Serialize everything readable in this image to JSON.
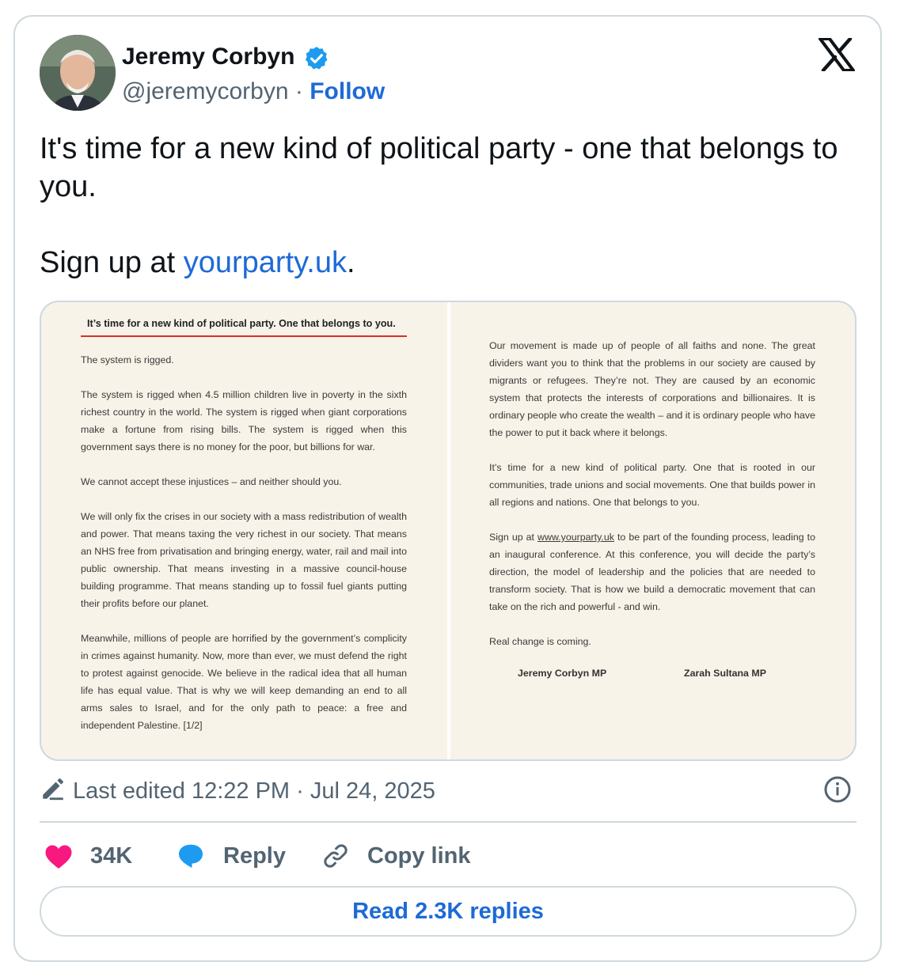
{
  "author": {
    "name": "Jeremy Corbyn",
    "handle": "@jeremycorbyn",
    "separator": "·",
    "follow_label": "Follow",
    "verified_icon": "verified-badge-icon",
    "avatar_icon": "profile-photo"
  },
  "brand_icon": "x-logo-icon",
  "tweet": {
    "line1": "It's time for a new kind of political party - one that belongs to you.",
    "line2_prefix": "Sign up at ",
    "line2_link": "yourparty.uk",
    "line2_suffix": "."
  },
  "media": {
    "title": "It’s time for a new kind of political party. One that belongs to you.",
    "left": [
      "The system is rigged.",
      "The system is rigged when 4.5 million children live in poverty in the sixth richest country in the world. The system is rigged when giant corporations make a fortune from rising bills. The system is rigged when this government says there is no money for the poor, but billions for war.",
      "We cannot accept these injustices – and neither should you.",
      "We will only fix the crises in our society with a mass redistribution of wealth and power. That means taxing the very richest in our society. That means an NHS free from privatisation and bringing energy, water, rail and mail into public ownership. That means investing in a massive council-house building programme. That means standing up to fossil fuel giants putting their profits before our planet.",
      "Meanwhile, millions of people are horrified by the government’s complicity in crimes against humanity. Now, more than ever, we must defend the right to protest against genocide. We believe in the radical idea that all human life has equal value. That is why we will keep demanding an end to all arms sales to Israel, and for the only path to peace: a free and independent Palestine. [1/2]"
    ],
    "right": [
      "Our movement is made up of people of all faiths and none. The great dividers want you to think that the problems in our society are caused by migrants or refugees. They’re not. They are caused by an economic system that protects the interests of corporations and billionaires. It is ordinary people who create the wealth – and it is ordinary people who have the power to put it back where it belongs.",
      "It’s time for a new kind of political party. One that is rooted in our communities, trade unions and social movements. One that builds power in all regions and nations. One that belongs to you."
    ],
    "signup_prefix": "Sign up at ",
    "signup_link": "www.yourparty.uk",
    "signup_rest": " to be part of the founding process, leading to an inaugural conference. At this conference, you will decide the party’s direction, the model of leadership and the policies that are needed to transform society. That is how we build a democratic movement that can take on the rich and powerful - and win.",
    "closing": "Real change is coming.",
    "signature_1": "Jeremy Corbyn MP",
    "signature_2": "Zarah Sultana MP"
  },
  "meta": {
    "edited_text": "Last edited 12:22 PM · Jul 24, 2025",
    "edit_icon": "pencil-icon",
    "info_icon": "info-icon"
  },
  "actions": {
    "like_count": "34K",
    "reply_label": "Reply",
    "copy_label": "Copy link",
    "like_color": "#f91880",
    "reply_color": "#1d9bf0"
  },
  "read_replies_label": "Read 2.3K replies",
  "colors": {
    "link": "#1d6ad7",
    "muted": "#536471",
    "border": "#cfd9de",
    "doc_background": "#f8f3e8",
    "doc_rule": "#d9312b"
  }
}
